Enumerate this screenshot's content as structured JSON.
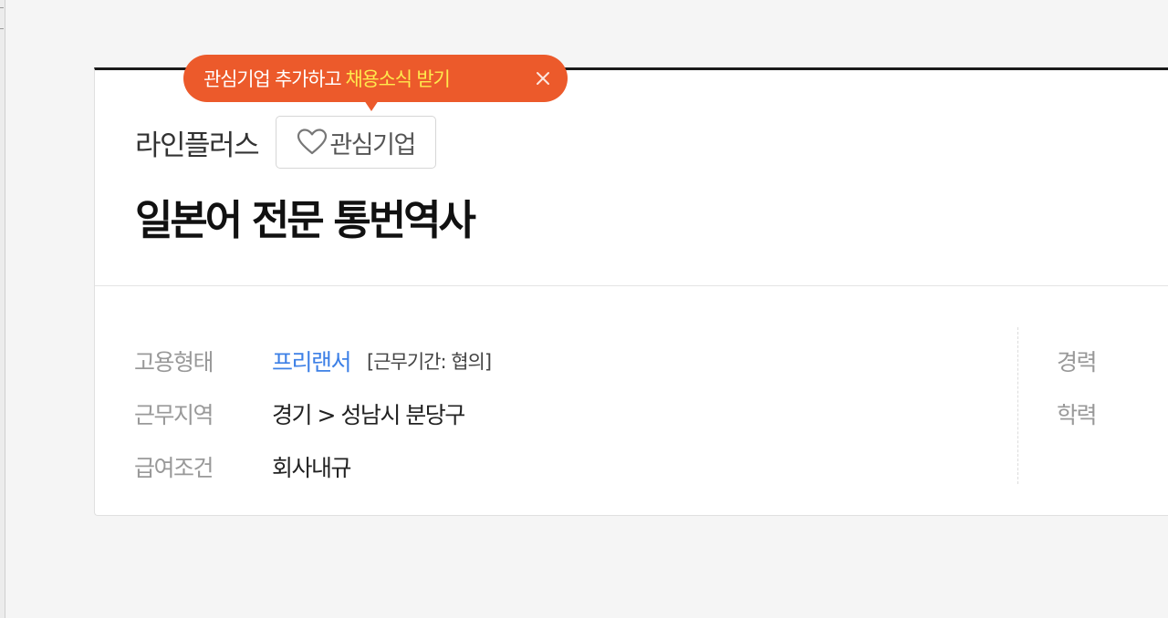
{
  "tooltip": {
    "text": "관심기업 추가하고",
    "highlight": "채용소식 받기",
    "close_icon": "close-icon"
  },
  "company": {
    "name": "라인플러스",
    "favorite_label": "관심기업",
    "favorite_icon": "heart-outline-icon"
  },
  "job": {
    "title": "일본어 전문 통번역사"
  },
  "details": {
    "left": [
      {
        "key": "고용형태",
        "value": "프리랜서",
        "extra": "[근무기간: 협의]"
      },
      {
        "key": "근무지역",
        "value": "경기 > 성남시 분당구"
      },
      {
        "key": "급여조건",
        "value": "회사내규"
      }
    ],
    "right": [
      {
        "key": "경력"
      },
      {
        "key": "학력"
      }
    ]
  },
  "colors": {
    "accent": "#ec5a2b",
    "highlight": "#ffe94d",
    "link": "#3d80e6"
  }
}
